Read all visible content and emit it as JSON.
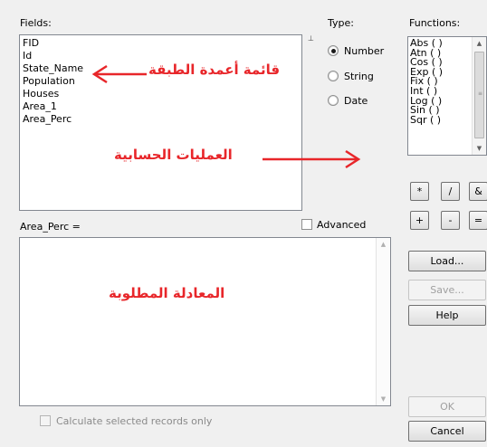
{
  "fields_panel": {
    "label": "Fields:",
    "items": [
      "FID",
      "Id",
      "State_Name",
      "Population",
      "Houses",
      "Area_1",
      "Area_Perc"
    ]
  },
  "type_panel": {
    "label": "Type:",
    "options": [
      {
        "label": "Number",
        "selected": true
      },
      {
        "label": "String",
        "selected": false
      },
      {
        "label": "Date",
        "selected": false
      }
    ]
  },
  "functions_panel": {
    "label": "Functions:",
    "items": [
      "Abs ( )",
      "Atn ( )",
      "Cos ( )",
      "Exp ( )",
      "Fix ( )",
      "Int ( )",
      "Log ( )",
      "Sin ( )",
      "Sqr ( )"
    ]
  },
  "operators": {
    "row1": [
      "*",
      "/",
      "&"
    ],
    "row2": [
      "+",
      "-",
      "="
    ]
  },
  "expression": {
    "label": "Area_Perc =",
    "value": ""
  },
  "advanced": {
    "label": "Advanced",
    "checked": false
  },
  "buttons": {
    "load": "Load...",
    "save": "Save...",
    "help": "Help",
    "ok": "OK",
    "cancel": "Cancel"
  },
  "calculate_selected": {
    "label": "Calculate selected records only",
    "checked": false,
    "enabled": false
  },
  "annotations": {
    "fields_list": "قائمة أعمدة الطبقة",
    "operations": "العمليات الحسابية",
    "equation": "المعادلة المطلوبة"
  },
  "colors": {
    "annotation": "#e8262a",
    "dialog_bg": "#f0f0f0"
  }
}
